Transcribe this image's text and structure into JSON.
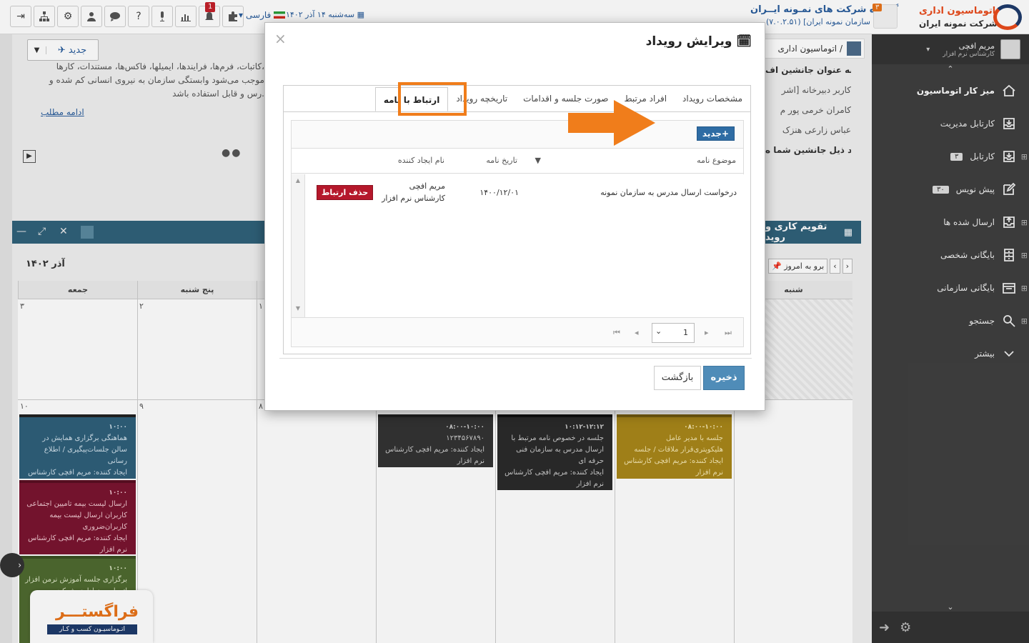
{
  "topbar": {
    "icons": [
      "exit-icon",
      "org-chart-icon",
      "gear-icon",
      "users-icon",
      "chat-icon",
      "help-icon",
      "mic-icon",
      "chart-icon",
      "bell-icon",
      "puzzle-icon"
    ],
    "notification_count": "1",
    "language": "فارسی",
    "date": "سه‌شنبه ۱۴ آذر ۱۴۰۲",
    "company_title": "گــروه شرکت های نمـونه ایــران",
    "company_sub": "(۷.۰.۲.۵۱)    [سازمان نمونه ایران",
    "company_badge": "۳",
    "brand_line1": "اتوماسیون اداری",
    "brand_line2": "شرکت نمونه ایران"
  },
  "sidebar": {
    "user_name": "مریم افچی",
    "user_role": "کارشناس نرم افزار",
    "items": [
      {
        "label": "میز کار اتوماسیون",
        "icon": "home-icon",
        "count": ""
      },
      {
        "label": "کارتابل مدیریت",
        "icon": "inbox-icon",
        "count": ""
      },
      {
        "label": "کارتابل",
        "icon": "inbox-icon",
        "count": "۳"
      },
      {
        "label": "پیش نویس",
        "icon": "edit-icon",
        "count": "۳۰"
      },
      {
        "label": "ارسال شده ها",
        "icon": "outbox-icon",
        "count": ""
      },
      {
        "label": "بایگانی شخصی",
        "icon": "cabinet-icon",
        "count": ""
      },
      {
        "label": "بایگانی سازمانی",
        "icon": "archive-icon",
        "count": ""
      },
      {
        "label": "جستجو",
        "icon": "search-icon",
        "count": ""
      },
      {
        "label": "بیشتر",
        "icon": "chevron-down-icon",
        "count": ""
      }
    ]
  },
  "background": {
    "new_button": "جدید",
    "news_lines": [
      "کاتبات، فرم‌ها، فرایندها، ایمیلها، فاکس‌ها، مستندات، کارها،",
      "موجب می‌شود وابستگی سازمان به نیروی انسانی کم شده و",
      "رس و قابل استفاده باشد."
    ],
    "read_more": "ادامه مطلب",
    "breadcrumb": "اتوماسیون اداری  /",
    "contacts_header": "شما به عنوان جانشین اف",
    "contacts": [
      "کاربر دبیرخانه [اشر",
      "کامران خرمی پور م",
      "عباس زارعی هنزک"
    ],
    "contacts_footer": "افراد ذیل جانشین شما ه",
    "calendar_title": "تقویم کاری و روید",
    "calendar_month": "آذر ۱۴۰۲",
    "today_button": "برو به امروز",
    "weekdays": [
      "جمعه",
      "پنج شنبه",
      "شنبه"
    ],
    "day_numbers": [
      "۳",
      "۲",
      "۱",
      "۱۰",
      "۹",
      "۸"
    ],
    "events": [
      {
        "time": "۱۰:۰۰",
        "text": "هماهنگی برگزاری همایش در سالن جلسات‌پیگیری / اطلاع رسانی",
        "creator": "ایجاد کننده: مریم افچی کارشناس نرم افزار",
        "color": "#2f5f7a"
      },
      {
        "time": "۱۰:۰۰",
        "text": "ارسال لیست بیمه تامیین اجتماعی کاربران ارسال لیست بیمه کاربران‌ضروری",
        "creator": "ایجاد کننده: مریم افچی کارشناس نرم افزار",
        "color": "#7a1530"
      },
      {
        "time": "۱۰:۰۰",
        "text": "برگزاری جلسه آموزش نرمن افزار اتوماسیون اداری شرکت بیمه",
        "creator": "",
        "color": "#4f6a30"
      },
      {
        "time": "۰۸:۰۰-۱۰:۰۰",
        "text": "۱۲۳۴۵۶۷۸۹۰",
        "creator": "ایجاد کننده: مریم افچی کارشناس نرم افزار",
        "color": "#333333"
      },
      {
        "time": "۱۰:۱۲-۱۲:۱۲",
        "text": "جلسه در خصوص نامه مرتبط با ارسال مدرس به سازمان فنی حرفه ای",
        "creator": "ایجاد کننده: مریم افچی کارشناس نرم افزار",
        "color": "#2b2b2b"
      },
      {
        "time": "۰۸:۰۰-۱۰:۰۰",
        "text": "جلسه با مدیر عامل هلیکوپتری‌قرار ملاقات / جلسه",
        "creator": "ایجاد کننده: مریم افچی کارشناس نرم افزار",
        "color": "#a8861a"
      }
    ]
  },
  "modal": {
    "title": "ویرایش رویداد",
    "close": "×",
    "tabs": [
      "مشخصات رویداد",
      "افراد مرتبط",
      "صورت جلسه و اقدامات",
      "تاریخچه رویداد",
      "ارتباط با نامه"
    ],
    "active_tab": "ارتباط با نامه",
    "new_button": "جدید",
    "columns": [
      "موضوع نامه",
      "تاریخ نامه",
      "نام ایجاد کننده"
    ],
    "rows": [
      {
        "subject": "درخواست ارسال مدرس به سازمان نمونه",
        "date": "۱۴۰۰/۱۲/۰۱",
        "creator_name": "مریم افچی",
        "creator_role": "کارشناس نرم افزار",
        "action": "حذف ارتباط"
      }
    ],
    "page_number": "1",
    "save": "ذخیره",
    "back": "بازگشت",
    "highlight_color": "#f07d1b"
  },
  "promo": {
    "title": "فراگستـــر",
    "subtitle": "اتـوماسیـون کسب و کـار"
  }
}
